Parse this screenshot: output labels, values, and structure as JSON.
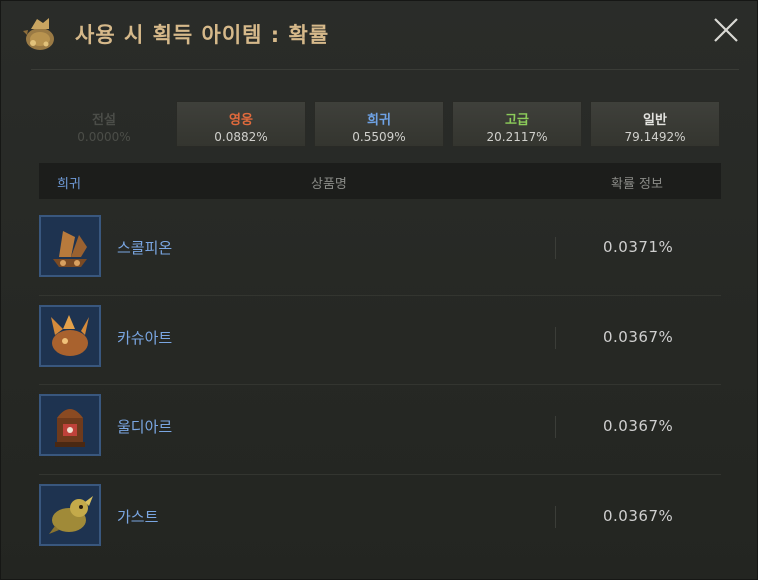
{
  "window": {
    "title": "사용 시 획득 아이템 : 확률",
    "title_icon": "treasure-pouch-icon",
    "close_icon": "close-icon"
  },
  "grade_tabs": [
    {
      "name": "전설",
      "pct": "0.0000%",
      "color": "#5a5b57",
      "disabled": true
    },
    {
      "name": "영웅",
      "pct": "0.0882%",
      "color": "#e06a3c",
      "disabled": false
    },
    {
      "name": "희귀",
      "pct": "0.5509%",
      "color": "#6fa3e6",
      "disabled": false
    },
    {
      "name": "고급",
      "pct": "20.2117%",
      "color": "#8ccc5a",
      "disabled": false
    },
    {
      "name": "일반",
      "pct": "79.1492%",
      "color": "#e4e4e0",
      "disabled": false
    }
  ],
  "list_header": {
    "grade": "희귀",
    "name": "상품명",
    "probability": "확률 정보"
  },
  "items": [
    {
      "name": "스콜피온",
      "probability": "0.0371%",
      "icon": "scorpion-ship-icon"
    },
    {
      "name": "카슈아트",
      "probability": "0.0367%",
      "icon": "kashuat-creature-icon"
    },
    {
      "name": "울디아르",
      "probability": "0.0367%",
      "icon": "uldiar-lantern-icon"
    },
    {
      "name": "가스트",
      "probability": "0.0367%",
      "icon": "gast-creature-icon"
    }
  ],
  "colors": {
    "title": "#d6b98a",
    "rare_text": "#7aa6e2",
    "item_frame": "#39577e"
  }
}
